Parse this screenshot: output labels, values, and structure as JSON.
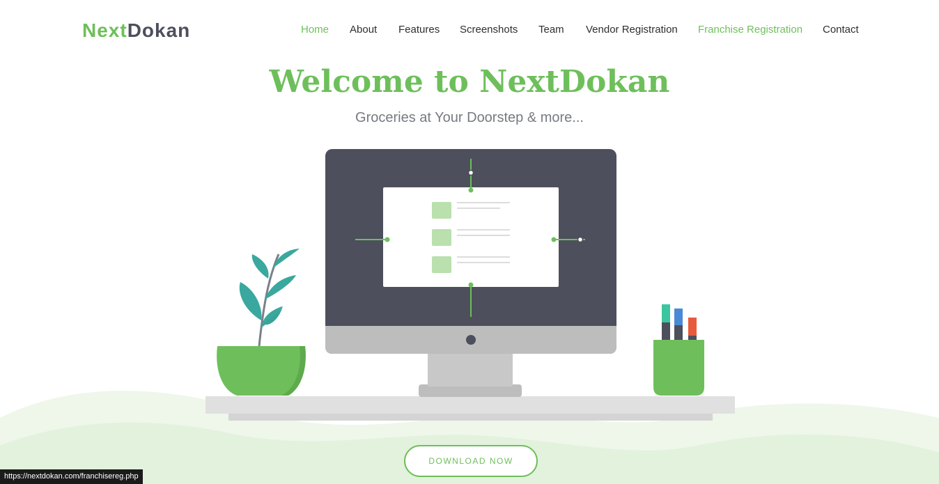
{
  "brand": {
    "part1": "Next",
    "part2": "Dokan"
  },
  "nav": [
    {
      "label": "Home",
      "active": true
    },
    {
      "label": "About"
    },
    {
      "label": "Features"
    },
    {
      "label": "Screenshots"
    },
    {
      "label": "Team"
    },
    {
      "label": "Vendor Registration"
    },
    {
      "label": "Franchise Registration",
      "hovered": true
    },
    {
      "label": "Contact"
    }
  ],
  "hero": {
    "title": "Welcome to NextDokan",
    "subtitle": "Groceries at Your Doorstep & more...",
    "download_label": "DOWNLOAD NOW"
  },
  "status_bar": {
    "url": "https://nextdokan.com/franchisereg.php"
  },
  "colors": {
    "brand_green": "#6ebf5b",
    "monitor_dark": "#4d4f5c",
    "light_green": "#e8f4e3",
    "leaf_teal": "#3aa89e"
  }
}
